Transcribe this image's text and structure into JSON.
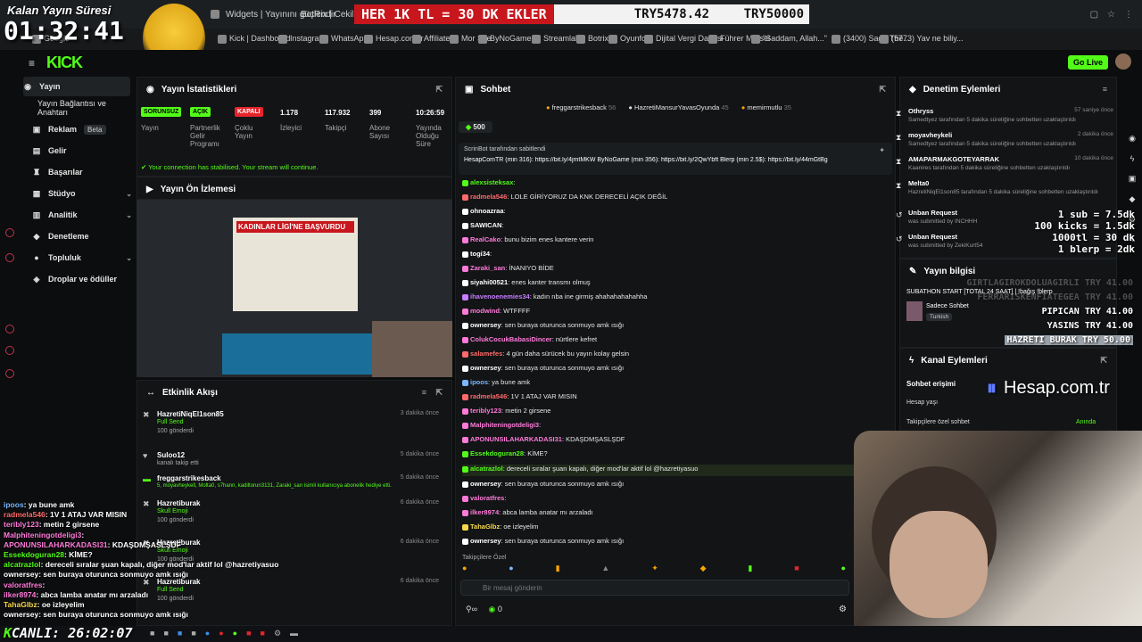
{
  "overlay": {
    "timer_label": "Kalan Yayın Süresi",
    "timer": "01:32:41",
    "ticker_red": "HER 1K TL = 30 DK EKLER",
    "ticker_current": "TRY5478.42",
    "ticker_goal": "TRY50000",
    "live_label": "CANLI: 26:02:07",
    "donations": [
      "1 sub = 7.5dk",
      "100 kicks = 1.5dk",
      "1000tl = 30 dk",
      "1 blerp = 2dk"
    ],
    "donation_list": [
      {
        "name": "GIRTLAGIROKDOLUAGIRLI",
        "amount": "TRY 41.00"
      },
      {
        "name": "FERRARISKENFİATEGEA",
        "amount": "TRY 41.00"
      },
      {
        "name": "PIPICAN",
        "amount": "TRY 41.00"
      },
      {
        "name": "YASINS",
        "amount": "TRY 41.00"
      },
      {
        "name": "HAZRETI BURAK",
        "amount": "TRY 50.00"
      }
    ],
    "sponsor": "Hesap.com.tr"
  },
  "browser": {
    "tabs": [
      "Widgets | Yayınını güçlendir",
      "BotRix | Cekilişler"
    ],
    "bookmarks": [
      "Google",
      "Kick | Dashboard",
      "Instagram",
      "WhatsApp",
      "Hesap.com.tr",
      "Affiliate",
      "Mor Site",
      "ByNoGame",
      "Streamlabs",
      "Botrix",
      "Oyunfor",
      "Dijital Vergi Dairesi",
      "Führer Mürsel",
      "\"Saddam, Allah...\"",
      "(3400) Sage The...",
      "(5773) Yav ne biliy..."
    ]
  },
  "app": {
    "logo": "KICK",
    "go_live": "Go Live"
  },
  "sidebar": {
    "items": [
      {
        "label": "Yayın",
        "icon": "broadcast-icon"
      },
      {
        "label": "Yayın Bağlantısı ve Anahtarı",
        "icon": ""
      },
      {
        "label": "Reklam",
        "icon": "ad-icon",
        "badge": "Beta"
      },
      {
        "label": "Gelir",
        "icon": "money-icon"
      },
      {
        "label": "Başarılar",
        "icon": "trophy-icon"
      },
      {
        "label": "Stüdyo",
        "icon": "studio-icon",
        "expand": true
      },
      {
        "label": "Analitik",
        "icon": "chart-icon",
        "expand": true
      },
      {
        "label": "Denetleme",
        "icon": "shield-icon"
      },
      {
        "label": "Topluluk",
        "icon": "community-icon",
        "expand": true
      },
      {
        "label": "Droplar ve ödüller",
        "icon": "gift-icon"
      }
    ]
  },
  "stats": {
    "title": "Yayın İstatistikleri",
    "items": [
      {
        "badge": "SORUNSUZ",
        "label": "Yayın",
        "color": "#53fc18"
      },
      {
        "badge": "AÇIK",
        "label": "Partnerlik Gelir Programı",
        "color": "#53fc18"
      },
      {
        "badge": "KAPALI",
        "label": "Çoklu Yayın",
        "color": "#e5242b"
      },
      {
        "value": "1.178",
        "label": "İzleyici"
      },
      {
        "value": "117.932",
        "label": "Takipçi"
      },
      {
        "value": "399",
        "label": "Abone Sayısı"
      },
      {
        "value": "10:26:59",
        "label": "Yayında Olduğu Süre"
      }
    ],
    "status": "Your connection has stabilised. Your stream will continue."
  },
  "preview": {
    "title": "Yayın Ön İzlemesi",
    "headline": "KADINLAR LİGİ'NE BAŞVURDU"
  },
  "activity": {
    "title": "Etkinlik Akışı",
    "items": [
      {
        "name": "HazretiNiqEl1son85",
        "sub": "Full Send",
        "extra": "100 gönderdi",
        "time": "3 dakika önce",
        "icon": "kick-icon"
      },
      {
        "name": "Suloo12",
        "sub": "kanalı takip etti",
        "extra": "",
        "time": "5 dakika önce",
        "icon": "heart-icon"
      },
      {
        "name": "freggarstrikesback",
        "sub": "5, moyavheykell, Molta0, s7hann, kadiltorun3131, Zaraki_san isimli kullanıcıya abonelik hediye etti.",
        "extra": "",
        "time": "5 dakika önce",
        "icon": "gift-icon"
      },
      {
        "name": "Hazretiburak",
        "sub": "Skull Emoji",
        "extra": "100 gönderdi",
        "time": "6 dakika önce",
        "icon": "kick-icon"
      },
      {
        "name": "Hazretiburak",
        "sub": "Skull Emoji",
        "extra": "100 gönderdi",
        "time": "6 dakika önce",
        "icon": "kick-icon"
      },
      {
        "name": "Hazretiburak",
        "sub": "Full Send",
        "extra": "100 gönderdi",
        "time": "6 dakika önce",
        "icon": "kick-icon"
      }
    ]
  },
  "chat": {
    "title": "Sohbet",
    "top_gifters": [
      {
        "name": "freggarstrikesback",
        "count": "56"
      },
      {
        "name": "HazretiMansurYavasOyunda",
        "count": "45"
      },
      {
        "name": "memirmutlu",
        "count": "35"
      }
    ],
    "kicks": "500",
    "pinned_by": "ScrinBot tarafından sabitlendi",
    "pinned_text": "HesapComTR (min 316): https://bit.ly/4jmtMKW ByNoGame (min 356): https://bit.ly/2QwYbft Blerp (min 2.5$): https://bit.ly/44mGtBg",
    "messages": [
      {
        "user": "alexsisteksax",
        "text": "",
        "color": "#53fc18"
      },
      {
        "user": "radmela546",
        "text": "LOLE GİRİYORUZ DA KNK DERECELİ AÇIK DEĞİL",
        "color": "#ff6a6a"
      },
      {
        "user": "ohnoazraa",
        "text": "",
        "color": "#ffffff"
      },
      {
        "user": "SAWICAN",
        "text": "",
        "color": "#ffffff"
      },
      {
        "user": "RealCako",
        "text": "bunu bizim enes kantere verin",
        "color": "#ff7ad9"
      },
      {
        "user": "togi34",
        "text": "",
        "color": "#ffffff"
      },
      {
        "user": "Zaraki_san",
        "text": "İNANIYO BİDE",
        "color": "#ff7ad9"
      },
      {
        "user": "siyahi00521",
        "text": "enes kanter transmı olmuş",
        "color": "#ffffff"
      },
      {
        "user": "ihavenoenemies34",
        "text": "kadın nba ine girmiş ahahahahahahha",
        "color": "#c77dff"
      },
      {
        "user": "modwind",
        "text": "WTFFFF",
        "color": "#ff7ad9"
      },
      {
        "user": "ownersey",
        "text": "sen buraya oturunca sonmuyo amk ısığı",
        "color": "#ffffff"
      },
      {
        "user": "ColukCocukBabasiDincer",
        "text": "nürtlere kefret",
        "color": "#ff7ad9"
      },
      {
        "user": "salamefes",
        "text": "4 gün daha sürücek bu yayın kolay gelsin",
        "color": "#ff6a6a"
      },
      {
        "user": "ownersey",
        "text": "sen buraya oturunca sonmuyo amk ısığı",
        "color": "#ffffff"
      },
      {
        "user": "ipoos",
        "text": "ya bune amk",
        "color": "#7ab8ff"
      },
      {
        "user": "radmela546",
        "text": "1V 1 ATAJ VAR MISIN",
        "color": "#ff6a6a"
      },
      {
        "user": "teribly123",
        "text": "metin 2 girsene",
        "color": "#ff7ad9"
      },
      {
        "user": "Malphiteningotdeligi3",
        "text": "",
        "color": "#ff7ad9"
      },
      {
        "user": "APONUNSILAHARKADASI31",
        "text": "KDAŞDMŞASLŞDF",
        "color": "#ff7ad9"
      },
      {
        "user": "Essekdoguran28",
        "text": "KİME?",
        "color": "#53fc18"
      },
      {
        "user": "alcatrazlol",
        "text": "dereceli sıralar şuan kapalı, diğer mod'lar aktif lol @hazretiyasuo",
        "color": "#53fc18"
      },
      {
        "user": "ownersey",
        "text": "sen buraya oturunca sonmuyo amk ısığı",
        "color": "#ffffff"
      },
      {
        "user": "valoratfres",
        "text": "",
        "color": "#ff7ad9"
      },
      {
        "user": "ilker8974",
        "text": "abca lamba anatar mı arzaladı",
        "color": "#ff7ad9"
      },
      {
        "user": "TahaGlbz",
        "text": "oe izleyelim",
        "color": "#f7d84c"
      },
      {
        "user": "ownersey",
        "text": "sen buraya oturunca sonmuyo amk ısığı",
        "color": "#ffffff"
      }
    ],
    "emote_tab": "Takipçilere Özel",
    "input_placeholder": "Bir mesaj gönderin",
    "kicks_count": "0"
  },
  "moderation": {
    "title": "Denetim Eylemleri",
    "items": [
      {
        "name": "Othryss",
        "desc": "Samedtyez tarafından 5 dakika süreliğine sohbetten uzaklaştırıldı",
        "time": "57 saniye önce",
        "icon": "timeout-icon"
      },
      {
        "name": "moyavheykeli",
        "desc": "Samedtyez tarafından 5 dakika süreliğine sohbetten uzaklaştırıldı",
        "time": "2 dakika önce",
        "icon": "timeout-icon"
      },
      {
        "name": "AMAPARMAKGOTEYARRAK",
        "desc": "Kaanires tarafından 5 dakika süreliğine sohbetten uzaklaştırıldı",
        "time": "10 dakika önce",
        "icon": "timeout-icon"
      },
      {
        "name": "Melta0",
        "desc": "HazretiNiqEl1son85 tarafından 5 dakika süreliğine sohbetten uzaklaştırıldı",
        "time": "",
        "icon": "timeout-icon"
      },
      {
        "name": "Unban Request",
        "desc": "was submitted by INCHHH",
        "time": "",
        "icon": "unban-icon"
      },
      {
        "name": "Unban Request",
        "desc": "was submitted by ZekiKurt54",
        "time": "",
        "icon": "unban-icon"
      }
    ]
  },
  "stream_info": {
    "title": "Yayın bilgisi",
    "stream_title": "SUBATHON START [TOTAL 24 SAAT] | !bağış !blerp",
    "category": "Sadece Sohbet",
    "tag": "Turkish"
  },
  "channel": {
    "title": "Kanal Eylemleri",
    "access": "Sohbet erişimi",
    "row1": "Hesap yaşı",
    "row2": "Takipçilere özel sohbet",
    "row2_value": "Anında"
  },
  "left_overlay_chat": [
    {
      "user": "ipoos",
      "text": "ya bune amk",
      "color": "#7ab8ff"
    },
    {
      "user": "radmela546",
      "text": "1V 1 ATAJ VAR MISIN",
      "color": "#ff6a6a"
    },
    {
      "user": "teribly123",
      "text": "metin 2 girsene",
      "color": "#ff7ad9"
    },
    {
      "user": "Malphiteningotdeligi3",
      "text": "",
      "color": "#ff7ad9"
    },
    {
      "user": "APONUNSILAHARKADASI31",
      "text": "KDAŞDMŞASLŞDF",
      "color": "#ff7ad9"
    },
    {
      "user": "Essekdoguran28",
      "text": "KİME?",
      "color": "#53fc18"
    },
    {
      "user": "alcatrazlol",
      "text": "dereceli sıralar şuan kapalı, diğer mod'lar aktif lol @hazretiyasuo",
      "color": "#53fc18"
    },
    {
      "user": "ownersey",
      "text": "sen buraya oturunca sonmuyo amk ısığı",
      "color": "#ffffff"
    },
    {
      "user": "valoratfres",
      "text": "",
      "color": "#ff7ad9"
    },
    {
      "user": "ilker8974",
      "text": "abca lamba anatar mı arzaladı",
      "color": "#ff7ad9"
    },
    {
      "user": "TahaGlbz",
      "text": "oe izleyelim",
      "color": "#f7d84c"
    },
    {
      "user": "ownersey",
      "text": "sen buraya oturunca sonmuyo amk ısığı",
      "color": "#ffffff"
    }
  ]
}
